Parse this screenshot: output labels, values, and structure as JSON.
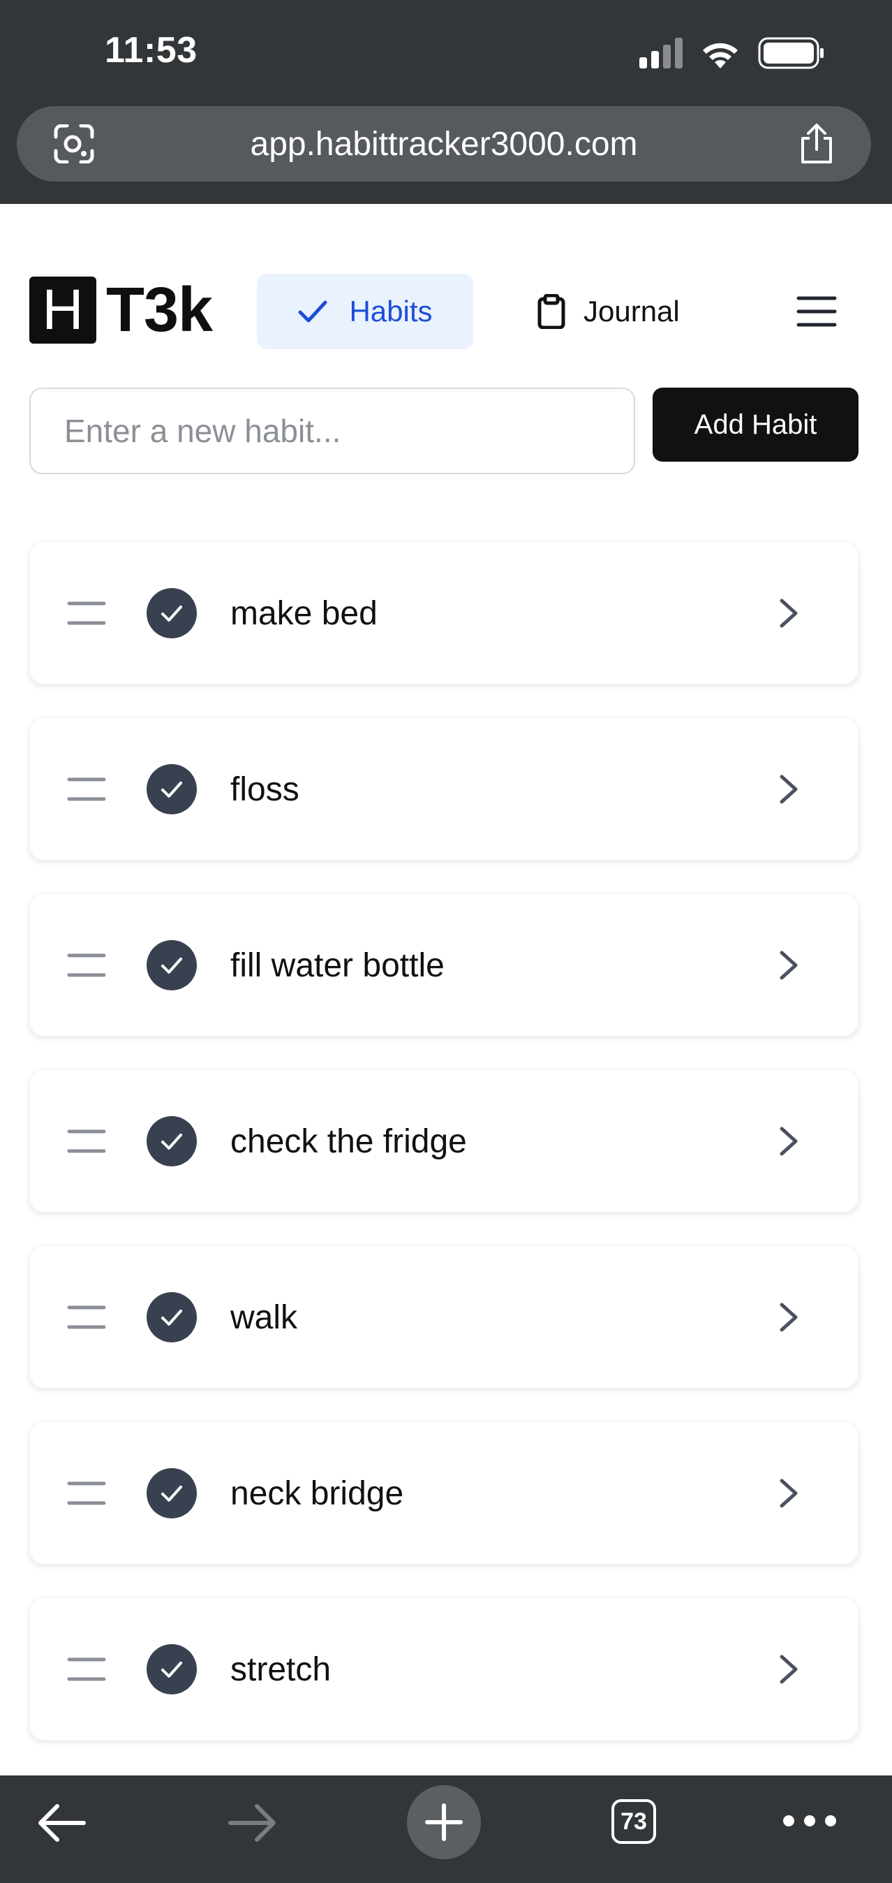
{
  "status_bar": {
    "time": "11:53",
    "icons": [
      "signal-icon",
      "wifi-icon",
      "battery-icon"
    ]
  },
  "browser": {
    "url": "app.habittracker3000.com",
    "tab_count": "73",
    "icons": [
      "screenshot-lens-icon",
      "share-icon",
      "back-arrow-icon",
      "forward-arrow-icon",
      "new-tab-icon",
      "tabs-icon",
      "more-icon"
    ]
  },
  "header": {
    "logo_letter": "H",
    "logo_text": "T3k",
    "nav": {
      "habits_label": "Habits",
      "journal_label": "Journal"
    },
    "icons": [
      "check-icon",
      "clipboard-icon",
      "hamburger-menu-icon"
    ]
  },
  "form": {
    "placeholder": "Enter a new habit...",
    "add_button_label": "Add Habit"
  },
  "habits": [
    {
      "label": "make bed",
      "completed": true
    },
    {
      "label": "floss",
      "completed": true
    },
    {
      "label": "fill water bottle",
      "completed": true
    },
    {
      "label": "check the fridge",
      "completed": true
    },
    {
      "label": "walk",
      "completed": true
    },
    {
      "label": "neck bridge",
      "completed": true
    },
    {
      "label": "stretch",
      "completed": true
    }
  ],
  "colors": {
    "chrome": "#333639",
    "accent_blue": "#1d4ed8",
    "accent_blue_bg": "#eaf2fe",
    "check_circle": "#394150",
    "primary_button": "#111111"
  }
}
